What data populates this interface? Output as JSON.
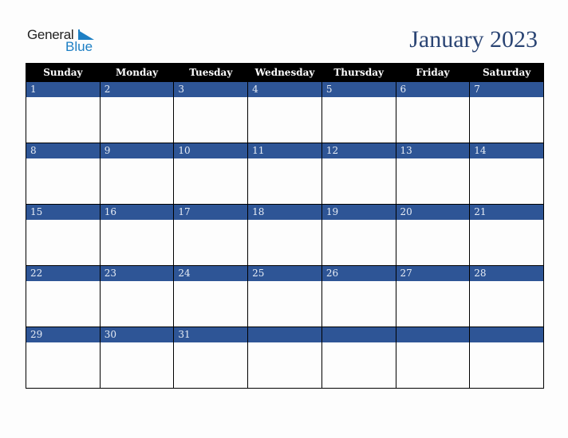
{
  "logo": {
    "line1": "General",
    "line2": "Blue",
    "icon": "triangle-flag-icon"
  },
  "title": "January 2023",
  "colors": {
    "header_bg": "#000000",
    "date_band": "#2e5596",
    "title": "#2b4574",
    "logo_blue": "#1d7fc4"
  },
  "weekdays": [
    "Sunday",
    "Monday",
    "Tuesday",
    "Wednesday",
    "Thursday",
    "Friday",
    "Saturday"
  ],
  "weeks": [
    [
      "1",
      "2",
      "3",
      "4",
      "5",
      "6",
      "7"
    ],
    [
      "8",
      "9",
      "10",
      "11",
      "12",
      "13",
      "14"
    ],
    [
      "15",
      "16",
      "17",
      "18",
      "19",
      "20",
      "21"
    ],
    [
      "22",
      "23",
      "24",
      "25",
      "26",
      "27",
      "28"
    ],
    [
      "29",
      "30",
      "31",
      "",
      "",
      "",
      ""
    ]
  ]
}
